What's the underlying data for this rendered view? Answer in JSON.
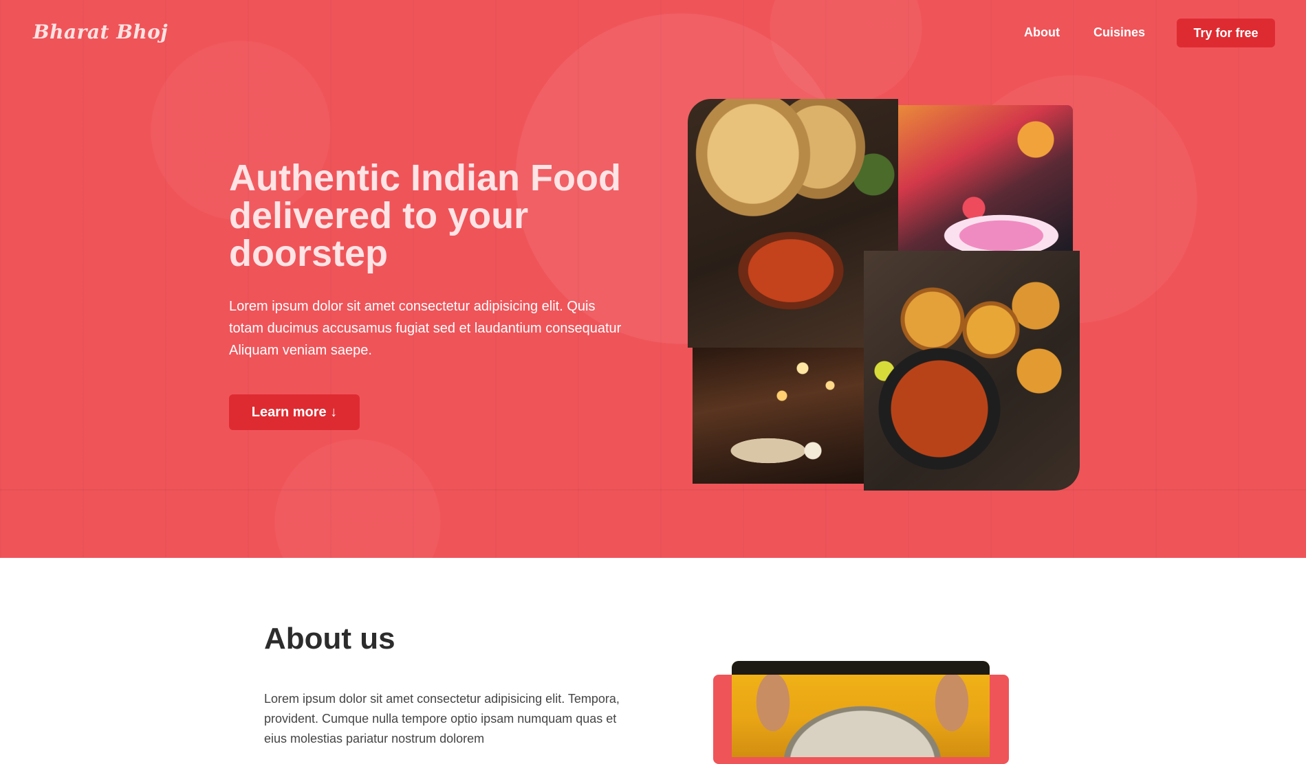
{
  "nav": {
    "logo": "Bharat Bhoj",
    "links": [
      "About",
      "Cuisines"
    ],
    "cta": "Try for free"
  },
  "hero": {
    "title": "Authentic Indian Food delivered to your doorstep",
    "text": "Lorem ipsum dolor sit amet consectetur adipisicing elit. Quis totam ducimus accusamus fugiat sed et laudantium consequatur Aliquam veniam saepe.",
    "button": "Learn more ↓"
  },
  "about": {
    "title": "About us",
    "text": "Lorem ipsum dolor sit amet consectetur adipisicing elit. Tempora, provident. Cumque nulla tempore optio ipsam numquam quas et eius molestias pariatur nostrum dolorem"
  },
  "colors": {
    "brand": "#ef5459",
    "button": "#de2b31",
    "heading_light": "#ffe4e6",
    "heading_dark": "#2c2c2c"
  }
}
